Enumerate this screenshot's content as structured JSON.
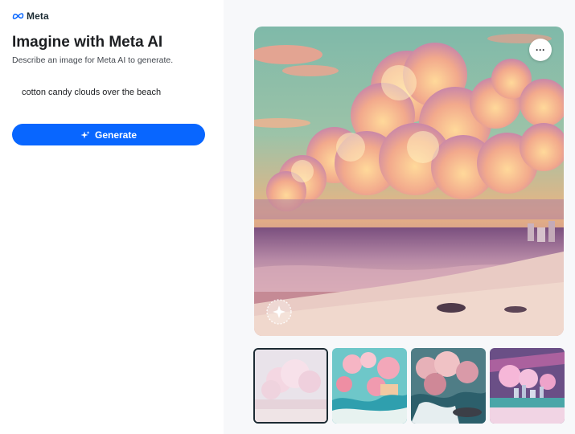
{
  "app": {
    "brand": "Meta"
  },
  "header": {
    "title": "Imagine with Meta AI",
    "subtitle": "Describe an image for Meta AI to generate."
  },
  "prompt": {
    "value": "cotton candy clouds over the beach"
  },
  "actions": {
    "generate_label": "Generate",
    "more_label": "···"
  },
  "gallery": {
    "main_image": "cotton candy clouds over the beach",
    "selected_index": 0,
    "thumbnails": [
      {
        "subject": "pastel pink clouds over sea"
      },
      {
        "subject": "pink trees by turquoise waves"
      },
      {
        "subject": "pink clouds over crashing waves"
      },
      {
        "subject": "pink clouds over city skyline and beach"
      }
    ]
  },
  "icons": {
    "brand": "meta-infinity-icon",
    "generate": "sparkle-icon",
    "more": "more-icon",
    "watermark": "imagined-with-ai-icon"
  },
  "colors": {
    "accent": "#0866ff",
    "selected_border": "#1c2b33"
  }
}
